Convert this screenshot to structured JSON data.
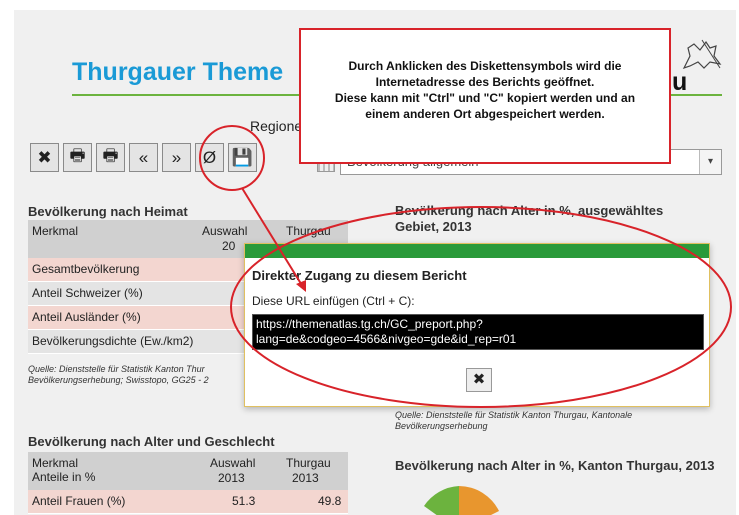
{
  "colors": {
    "title_blue": "#1a9ad6",
    "accent_red": "#d8232a",
    "modal_green": "#2a9a3a",
    "pink_row": "#f3d6d0",
    "table_header": "#d0d0d0"
  },
  "banner": {
    "title": "Thurgauer Theme",
    "title_tail": "u",
    "crest_icon": "thurgau-lion-icon"
  },
  "region_label": "Regione",
  "toolbar": {
    "buttons": [
      {
        "icon": "close-x-icon",
        "glyph": "✖"
      },
      {
        "icon": "printer-icon",
        "glyph": "🖶"
      },
      {
        "icon": "printer-alt-icon",
        "glyph": "🖶"
      },
      {
        "icon": "double-left-icon",
        "glyph": "«"
      },
      {
        "icon": "double-right-icon",
        "glyph": "»"
      },
      {
        "icon": "empty-set-icon",
        "glyph": "Ø"
      },
      {
        "icon": "floppy-disk-icon",
        "glyph": "💾"
      }
    ],
    "select_value": "Bevölkerung allgemein",
    "select_arrow": "▾"
  },
  "callout": {
    "text_line1": "Durch Anklicken des Diskettensymbols wird die",
    "text_line2": "Internetadresse des Berichts geöffnet.",
    "text_line3": "Diese kann mit \"Ctrl\" und \"C\" kopiert werden und an",
    "text_line4": "einem anderen Ort abgespeichert werden."
  },
  "section_heimat": {
    "title": "Bevölkerung nach Heimat",
    "col_merkmal": "Merkmal",
    "col_auswahl": "Auswahl",
    "col_auswahl_year": "20",
    "col_thurgau": "Thurgau",
    "rows": [
      "Gesamtbevölkerung",
      "Anteil Schweizer (%)",
      "Anteil Ausländer (%)",
      "Bevölkerungsdichte (Ew./km2)"
    ],
    "source_line1": "Quelle: Dienststelle für Statistik Kanton Thur",
    "source_line2": "Bevölkerungserhebung; Swisstopo, GG25 - 2"
  },
  "section_alter_gebiet": {
    "title_line1": "Bevölkerung nach Alter in %, ausgewähltes",
    "title_line2": "Gebiet, 2013",
    "source_line1": "Quelle: Dienststelle für Statistik Kanton Thurgau, Kantonale",
    "source_line2": "Bevölkerungserhebung"
  },
  "section_alter_geschlecht": {
    "title": "Bevölkerung nach Alter und Geschlecht",
    "col_merkmal": "Merkmal",
    "col_merkmal_sub": "Anteile in %",
    "col_auswahl": "Auswahl",
    "col_auswahl_year": "2013",
    "col_thurgau": "Thurgau",
    "col_thurgau_year": "2013",
    "row_label": "Anteil Frauen (%)",
    "row_auswahl": "51.3",
    "row_thurgau": "49.8"
  },
  "section_alter_kanton": {
    "title": "Bevölkerung nach Alter in %, Kanton Thurgau, 2013"
  },
  "modal": {
    "title": "Direkter Zugang zu diesem Bericht",
    "label": "Diese URL einfügen (Ctrl + C):",
    "url": "https://themenatlas.tg.ch/GC_preport.php?lang=de&codgeo=4566&nivgeo=gde&id_rep=r01",
    "close_glyph": "✖"
  }
}
